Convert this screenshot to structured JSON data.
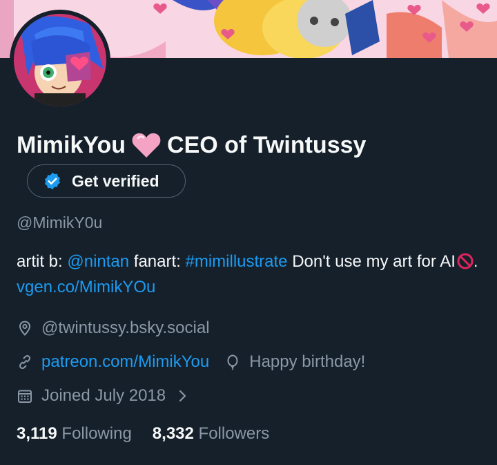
{
  "profile": {
    "display_name": "MimikYou",
    "title_suffix": "CEO of Twintussy",
    "handle": "@MimikY0u",
    "verify_label": "Get verified"
  },
  "bio": {
    "prefix": "artit  b: ",
    "mention": "@nintan",
    "fanart_label": " fanart: ",
    "hashtag": "#mimillustrate",
    "text": " Don't use my art for AI",
    "link": "vgen.co/MimikYOu"
  },
  "meta": {
    "location": "@twintussy.bsky.social",
    "website": "patreon.com/MimikYou",
    "birthday": "Happy birthday!",
    "joined": "Joined July 2018"
  },
  "stats": {
    "following_count": "3,119",
    "following_label": "Following",
    "followers_count": "8,332",
    "followers_label": "Followers"
  },
  "colors": {
    "background": "#15202b",
    "link": "#1d9bf0",
    "muted": "#8b98a5",
    "verified_badge": "#1d9bf0"
  }
}
